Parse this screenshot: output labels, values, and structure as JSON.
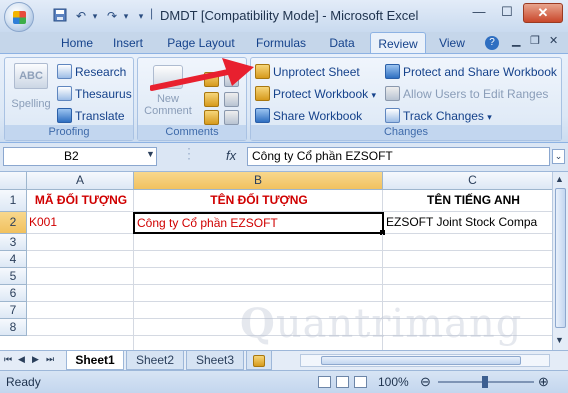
{
  "titlebar": {
    "title": "DMDT  [Compatibility Mode] - Microsoft Excel",
    "qat_icons": [
      "save-icon",
      "undo-icon",
      "redo-icon"
    ],
    "min": "—",
    "max": "☐",
    "close": "✕"
  },
  "tabs": [
    "Home",
    "Insert",
    "Page Layout",
    "Formulas",
    "Data",
    "Review",
    "View"
  ],
  "active_tab": "Review",
  "ribbon": {
    "proofing": {
      "spelling": "Spelling",
      "research": "Research",
      "thesaurus": "Thesaurus",
      "translate": "Translate",
      "label": "Proofing"
    },
    "comments": {
      "new_comment": "New Comment",
      "label": "Comments"
    },
    "changes": {
      "unprotect_sheet": "Unprotect Sheet",
      "protect_workbook": "Protect Workbook",
      "share_workbook": "Share Workbook",
      "protect_share": "Protect and Share Workbook",
      "allow_users": "Allow Users to Edit Ranges",
      "track_changes": "Track Changes",
      "label": "Changes"
    },
    "ABC": "ABC"
  },
  "formula_bar": {
    "namebox": "B2",
    "fx": "fx",
    "content": "Công ty Cổ phần EZSOFT"
  },
  "grid": {
    "columns": [
      "A",
      "B",
      "C"
    ],
    "rows": [
      "1",
      "2",
      "3",
      "4",
      "5",
      "6",
      "7",
      "8"
    ],
    "cells": {
      "A1": "MÃ ĐỐI TƯỢNG",
      "B1": "TÊN ĐỐI TƯỢNG",
      "C1": "TÊN TIẾNG ANH",
      "A2": "K001",
      "B2": "Công ty Cổ phần EZSOFT",
      "C2": "EZSOFT Joint Stock Compa"
    }
  },
  "sheets": [
    "Sheet1",
    "Sheet2",
    "Sheet3"
  ],
  "active_sheet": "Sheet1",
  "status": {
    "mode": "Ready",
    "zoom": "100%"
  },
  "watermark": "uantrimang",
  "colors": {
    "accent_red": "#d00000",
    "arrow": "#e8202f",
    "active_tab": "#eaf1fa"
  }
}
